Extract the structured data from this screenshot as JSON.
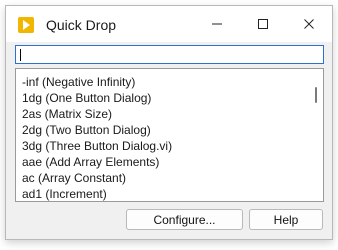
{
  "window": {
    "title": "Quick Drop",
    "accent": "#f2b600"
  },
  "search": {
    "value": ""
  },
  "list": {
    "items": [
      "-inf (Negative Infinity)",
      "1dg (One Button Dialog)",
      "2as (Matrix Size)",
      "2dg (Two Button Dialog)",
      "3dg  (Three Button Dialog.vi)",
      "aae (Add Array Elements)",
      "ac (Array Constant)",
      "ad1 (Increment)"
    ]
  },
  "buttons": {
    "configure": "Configure...",
    "help": "Help"
  }
}
